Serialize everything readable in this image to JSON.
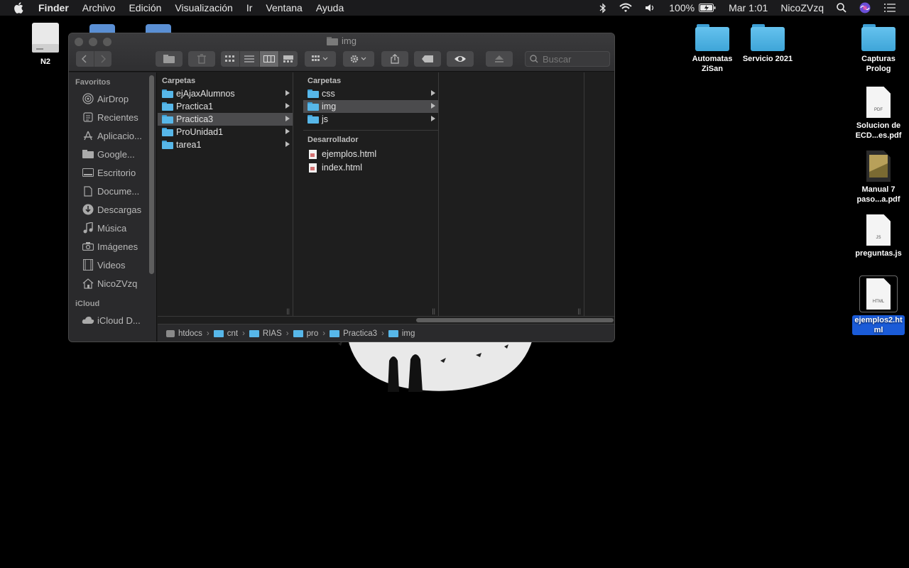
{
  "menubar": {
    "app_name": "Finder",
    "menus": [
      "Archivo",
      "Edición",
      "Visualización",
      "Ir",
      "Ventana",
      "Ayuda"
    ],
    "battery": "100%",
    "clock": "Mar 1:01",
    "user": "NicoZVzq",
    "status_icons": [
      "bluetooth-icon",
      "wifi-icon",
      "volume-icon",
      "battery-icon",
      "search-icon",
      "siri-icon",
      "control-center-icon"
    ]
  },
  "desktop": {
    "left_icons": [
      {
        "label": "N2",
        "icon": "drive-icon"
      }
    ],
    "folders": [
      {
        "label": "Automatas ZiSan"
      },
      {
        "label": "Servicio 2021"
      },
      {
        "label": "Capturas Prolog"
      }
    ],
    "files": [
      {
        "label": "Solucion de ECD...es.pdf",
        "ext": "PDF"
      },
      {
        "label": "Manual 7 paso...a.pdf",
        "ext": "PDF"
      },
      {
        "label": "preguntas.js",
        "ext": "JS"
      },
      {
        "label": "ejemplos2.html",
        "ext": "HTML",
        "selected": true
      }
    ]
  },
  "finder": {
    "title": "img",
    "search_placeholder": "Buscar",
    "sidebar": {
      "section_favorites": "Favoritos",
      "favorites": [
        {
          "label": "AirDrop",
          "icon": "airdrop-icon"
        },
        {
          "label": "Recientes",
          "icon": "clock-icon"
        },
        {
          "label": "Aplicacio...",
          "icon": "applications-icon"
        },
        {
          "label": "Google...",
          "icon": "folder-icon"
        },
        {
          "label": "Escritorio",
          "icon": "desktop-icon"
        },
        {
          "label": "Docume...",
          "icon": "document-icon"
        },
        {
          "label": "Descargas",
          "icon": "download-icon"
        },
        {
          "label": "Música",
          "icon": "music-icon"
        },
        {
          "label": "Imágenes",
          "icon": "camera-icon"
        },
        {
          "label": "Videos",
          "icon": "film-icon"
        },
        {
          "label": "NicoZVzq",
          "icon": "home-icon"
        }
      ],
      "section_icloud": "iCloud",
      "icloud": [
        {
          "label": "iCloud D...",
          "icon": "cloud-icon"
        }
      ]
    },
    "column1": {
      "header": "Carpetas",
      "items": [
        "ejAjaxAlumnos",
        "Practica1",
        "Practica3",
        "ProUnidad1",
        "tarea1"
      ],
      "selected_index": 2
    },
    "column2": {
      "header": "Carpetas",
      "items": [
        "css",
        "img",
        "js"
      ],
      "selected_index": 1,
      "section2_header": "Desarrollador",
      "files": [
        "ejemplos.html",
        "index.html"
      ]
    },
    "path": [
      "htdocs",
      "cnt",
      "RIAS",
      "pro",
      "Practica3",
      "img"
    ]
  }
}
